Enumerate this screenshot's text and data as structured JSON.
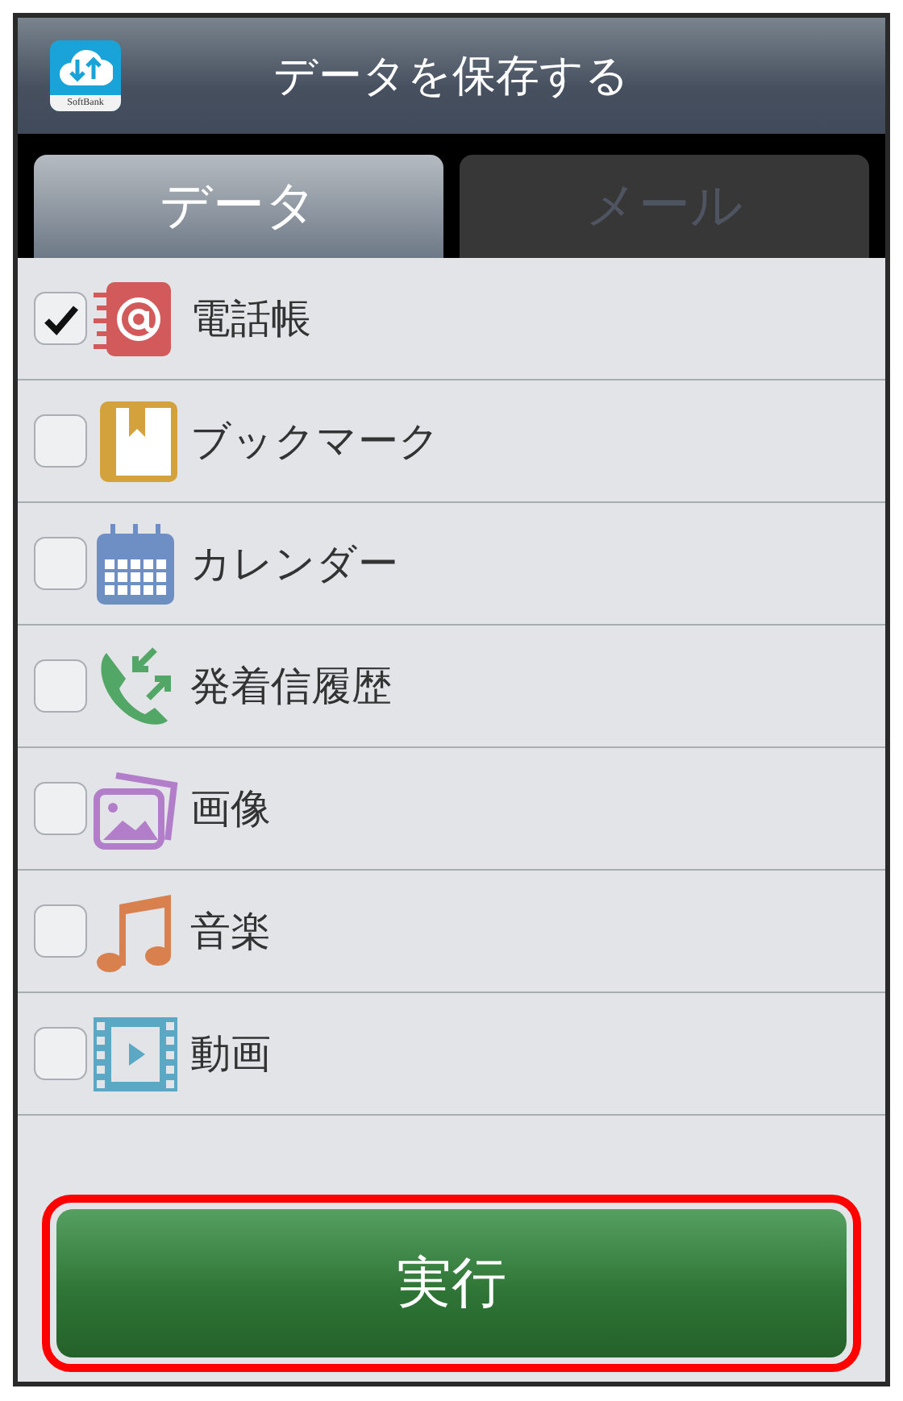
{
  "header": {
    "title": "データを保存する",
    "logo_label": "SoftBank"
  },
  "tabs": [
    {
      "label": "データ",
      "selected": true
    },
    {
      "label": "メール",
      "selected": false
    }
  ],
  "items": [
    {
      "kind": "contacts",
      "label": "電話帳",
      "checked": true
    },
    {
      "kind": "bookmark",
      "label": "ブックマーク",
      "checked": false
    },
    {
      "kind": "calendar",
      "label": "カレンダー",
      "checked": false
    },
    {
      "kind": "calls",
      "label": "発着信履歴",
      "checked": false
    },
    {
      "kind": "images",
      "label": "画像",
      "checked": false
    },
    {
      "kind": "music",
      "label": "音楽",
      "checked": false
    },
    {
      "kind": "video",
      "label": "動画",
      "checked": false
    }
  ],
  "action": {
    "label": "実行",
    "highlighted": true
  }
}
